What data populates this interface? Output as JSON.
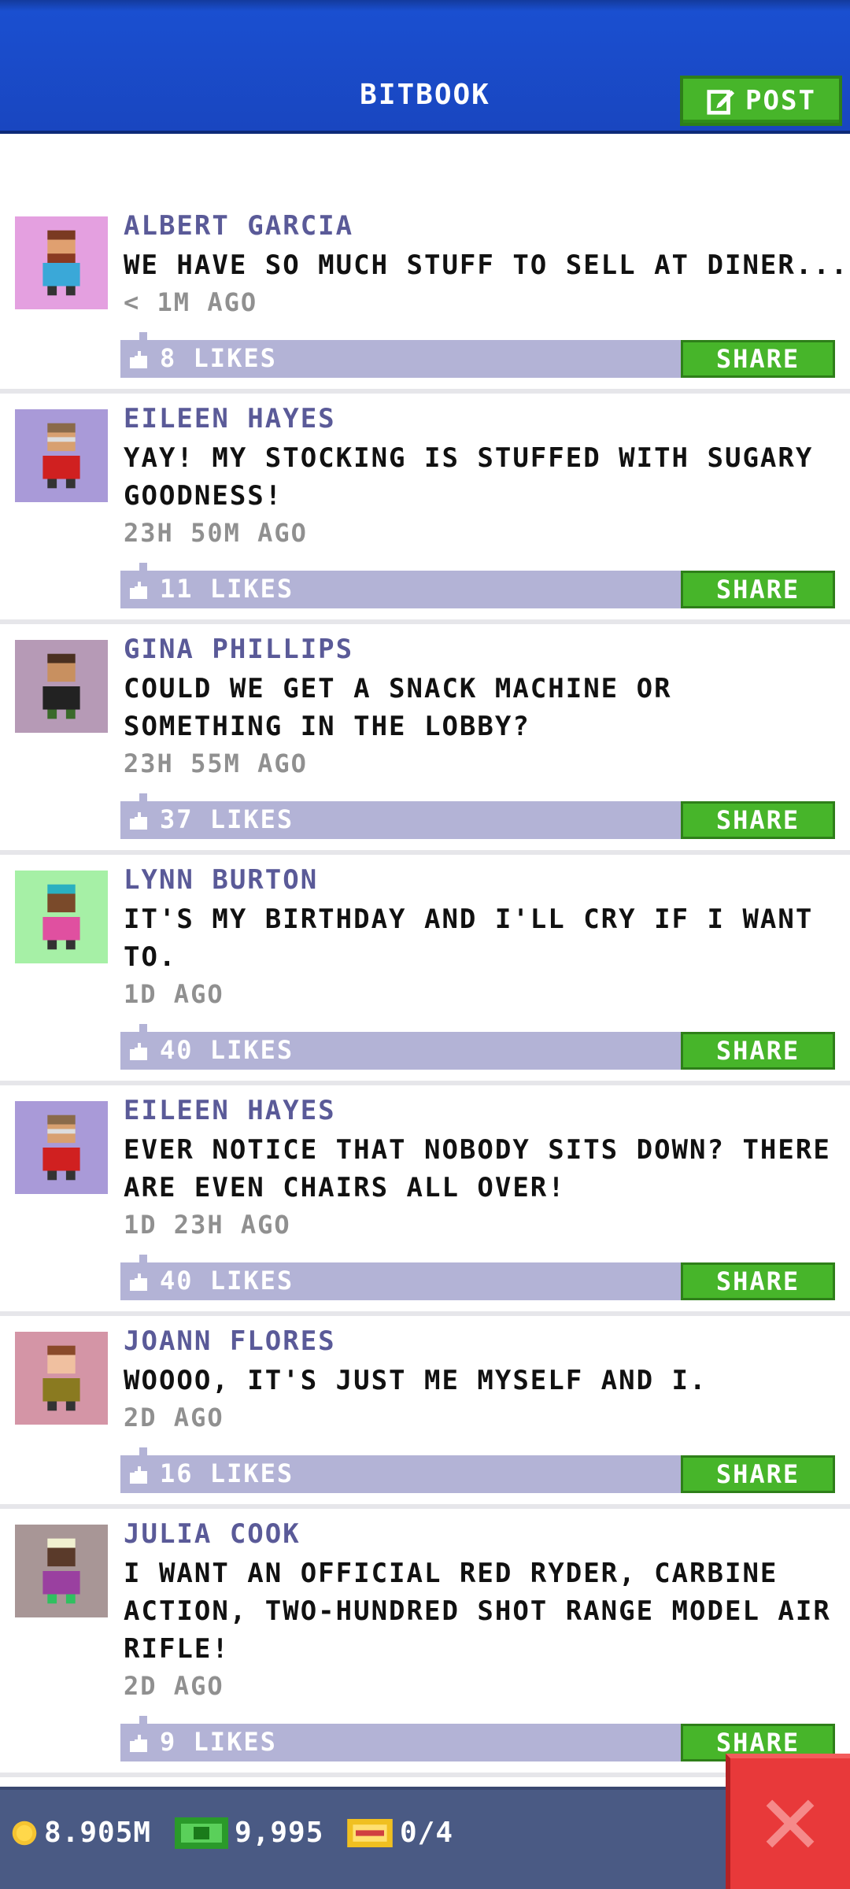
{
  "header": {
    "title": "BITBOOK",
    "post_label": "POST"
  },
  "posts": [
    {
      "name": "ALBERT GARCIA",
      "text": "WE HAVE SO MUCH STUFF TO SELL AT DINER...",
      "time": "< 1M AGO",
      "likes": "8 LIKES",
      "share": "SHARE",
      "avatar_bg": "#e4a0e0"
    },
    {
      "name": "EILEEN HAYES",
      "text": "YAY! MY STOCKING IS STUFFED WITH SUGARY GOODNESS!",
      "time": "23H 50M AGO",
      "likes": "11 LIKES",
      "share": "SHARE",
      "avatar_bg": "#a99ad8"
    },
    {
      "name": "GINA PHILLIPS",
      "text": "COULD WE GET A SNACK MACHINE OR SOMETHING IN THE LOBBY?",
      "time": "23H 55M AGO",
      "likes": "37 LIKES",
      "share": "SHARE",
      "avatar_bg": "#b69ab6"
    },
    {
      "name": "LYNN BURTON",
      "text": "IT'S MY BIRTHDAY AND I'LL CRY IF I WANT TO.",
      "time": "1D AGO",
      "likes": "40 LIKES",
      "share": "SHARE",
      "avatar_bg": "#a6f0a6"
    },
    {
      "name": "EILEEN HAYES",
      "text": "EVER NOTICE THAT NOBODY SITS DOWN? THERE ARE EVEN CHAIRS ALL OVER!",
      "time": "1D 23H AGO",
      "likes": "40 LIKES",
      "share": "SHARE",
      "avatar_bg": "#a99ad8"
    },
    {
      "name": "JOANN FLORES",
      "text": "WOOOO, IT'S JUST ME MYSELF AND I.",
      "time": "2D AGO",
      "likes": "16 LIKES",
      "share": "SHARE",
      "avatar_bg": "#d495a6"
    },
    {
      "name": "JULIA COOK",
      "text": "I WANT AN OFFICIAL RED RYDER, CARBINE ACTION, TWO-HUNDRED SHOT RANGE MODEL AIR RIFLE!",
      "time": "2D AGO",
      "likes": "9 LIKES",
      "share": "SHARE",
      "avatar_bg": "#a89696"
    }
  ],
  "bottom": {
    "coins": "8.905M",
    "bux": "9,995",
    "tickets": "0/4"
  },
  "icons": {
    "post": "edit-icon",
    "like": "thumbs-up-icon",
    "coin": "coin-icon",
    "bux": "cash-icon",
    "ticket": "ticket-icon",
    "close": "close-icon"
  },
  "colors": {
    "header": "#1a4fd0",
    "accent_green": "#47b52a",
    "likes_bar": "#b3b3d6",
    "name": "#5a5a98",
    "close_red": "#e8393a"
  }
}
